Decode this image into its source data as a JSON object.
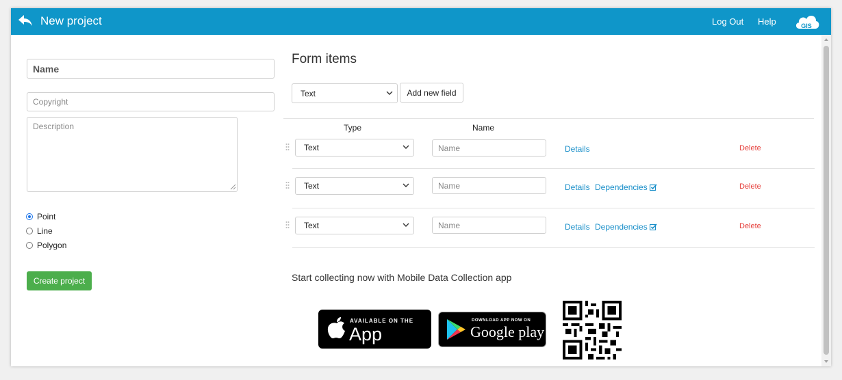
{
  "header": {
    "title": "New project",
    "links": [
      "Log Out",
      "Help"
    ],
    "logo_text": "GIS"
  },
  "project_form": {
    "name_placeholder": "Name",
    "copyright_placeholder": "Copyright",
    "description_placeholder": "Description",
    "geometry_options": [
      {
        "label": "Point",
        "selected": true
      },
      {
        "label": "Line",
        "selected": false
      },
      {
        "label": "Polygon",
        "selected": false
      }
    ],
    "create_button": "Create project"
  },
  "form_items": {
    "title": "Form items",
    "new_field_type": "Text",
    "add_button": "Add new field",
    "columns": [
      "Type",
      "Name"
    ],
    "rows": [
      {
        "type": "Text",
        "name_placeholder": "Name",
        "details": "Details",
        "dependencies": "",
        "delete": "Delete"
      },
      {
        "type": "Text",
        "name_placeholder": "Name",
        "details": "Details",
        "dependencies": "Dependencies",
        "delete": "Delete"
      },
      {
        "type": "Text",
        "name_placeholder": "Name",
        "details": "Details",
        "dependencies": "Dependencies",
        "delete": "Delete"
      }
    ]
  },
  "promo": {
    "text": "Start collecting now with Mobile Data Collection app",
    "app_store": {
      "small": "AVAILABLE ON THE",
      "big": "App Store"
    },
    "google_play": {
      "small": "DOWNLOAD APP NOW ON",
      "big": "Google play"
    }
  },
  "colors": {
    "header": "#0f96c9",
    "create_button": "#4cae4c",
    "link": "#1a8fc9",
    "delete": "#e53935"
  }
}
